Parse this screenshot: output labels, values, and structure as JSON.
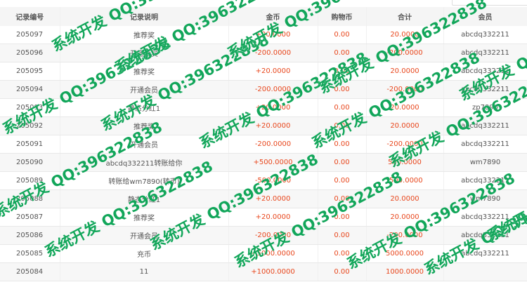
{
  "table": {
    "headers": [
      "记录编号",
      "记录说明",
      "金币",
      "购物币",
      "合计",
      "会员"
    ],
    "rows": [
      [
        "205097",
        "推荐奖",
        "+20.0000",
        "0.00",
        "20.0000",
        "abcdq332211"
      ],
      [
        "205096",
        "开通会员",
        "-200.0000",
        "0.00",
        "-200.0000",
        "abcdq332211"
      ],
      [
        "205095",
        "推荐奖",
        "+20.0000",
        "0.00",
        "20.0000",
        "abcdq332211"
      ],
      [
        "205094",
        "开通会员",
        "-200.0000",
        "0.00",
        "-200.0000",
        "abcdq332211"
      ],
      [
        "205093",
        "静态分红1",
        "+20.0000",
        "0.00",
        "20.0000",
        "zp7890"
      ],
      [
        "205092",
        "推荐奖",
        "+20.0000",
        "0.00",
        "20.0000",
        "abcdq332211"
      ],
      [
        "205091",
        "开通会员",
        "-200.0000",
        "0.00",
        "-200.0000",
        "abcdq332211"
      ],
      [
        "205090",
        "abcdq332211转账给你",
        "+500.0000",
        "0.00",
        "500.0000",
        "wm7890"
      ],
      [
        "205089",
        "转账给wm7890(转币)",
        "-500.0000",
        "0.00",
        "-500.0000",
        "abcdq332211"
      ],
      [
        "205088",
        "静态分红1",
        "+20.0000",
        "0.00",
        "20.0000",
        "wm7890"
      ],
      [
        "205087",
        "推荐奖",
        "+20.0000",
        "0.00",
        "20.0000",
        "abcdq332211"
      ],
      [
        "205086",
        "开通会员",
        "-200.0000",
        "0.00",
        "-200.0000",
        "abcdq332211"
      ],
      [
        "205085",
        "充币",
        "+5000.0000",
        "0.00",
        "5000.0000",
        "abcdq332211"
      ],
      [
        "205084",
        "11",
        "+1000.0000",
        "0.00",
        "1000.0000",
        ""
      ]
    ]
  },
  "watermark": {
    "text": "系统开发 QQ:396322838",
    "color": "#12a65a"
  },
  "colors": {
    "amount": "#e8471d",
    "header_bg": "#f5f5f5"
  }
}
